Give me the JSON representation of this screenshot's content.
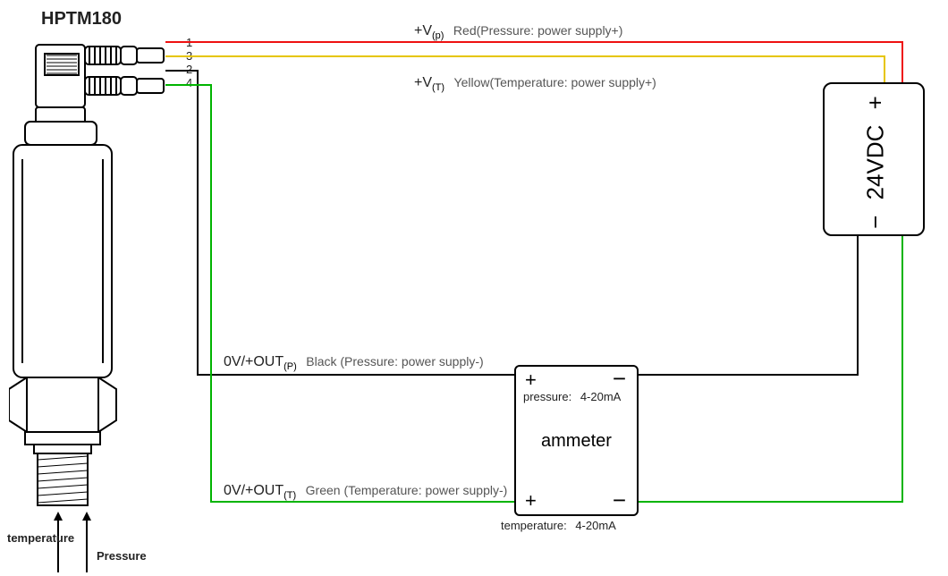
{
  "title": "HPTM180",
  "pins": {
    "p1": "1",
    "p2": "2",
    "p3": "3",
    "p4": "4"
  },
  "wires": {
    "red": {
      "symbol": "+V",
      "sub": "(p)",
      "desc": "Red(Pressure: power supply+)",
      "color": "#e11"
    },
    "yellow": {
      "symbol": "+V",
      "sub": "(T)",
      "desc": "Yellow(Temperature: power supply+)",
      "color": "#e6c500"
    },
    "black": {
      "symbol": "0V/+OUT",
      "sub": "(P)",
      "desc": "Black (Pressure: power supply-)",
      "color": "#000"
    },
    "green": {
      "symbol": "0V/+OUT",
      "sub": "(T)",
      "desc": "Green (Temperature: power supply-)",
      "color": "#00b400"
    }
  },
  "ammeter": {
    "label": "ammeter",
    "pressure_prefix": "pressure:",
    "pressure_value": "4-20mA",
    "temperature_prefix": "temperature:",
    "temperature_value": "4-20mA",
    "plus": "+",
    "minus": "−"
  },
  "psu": {
    "label": "24VDC",
    "plus": "+",
    "minus": "−"
  },
  "inputs": {
    "temperature": "temperature",
    "pressure": "Pressure"
  }
}
